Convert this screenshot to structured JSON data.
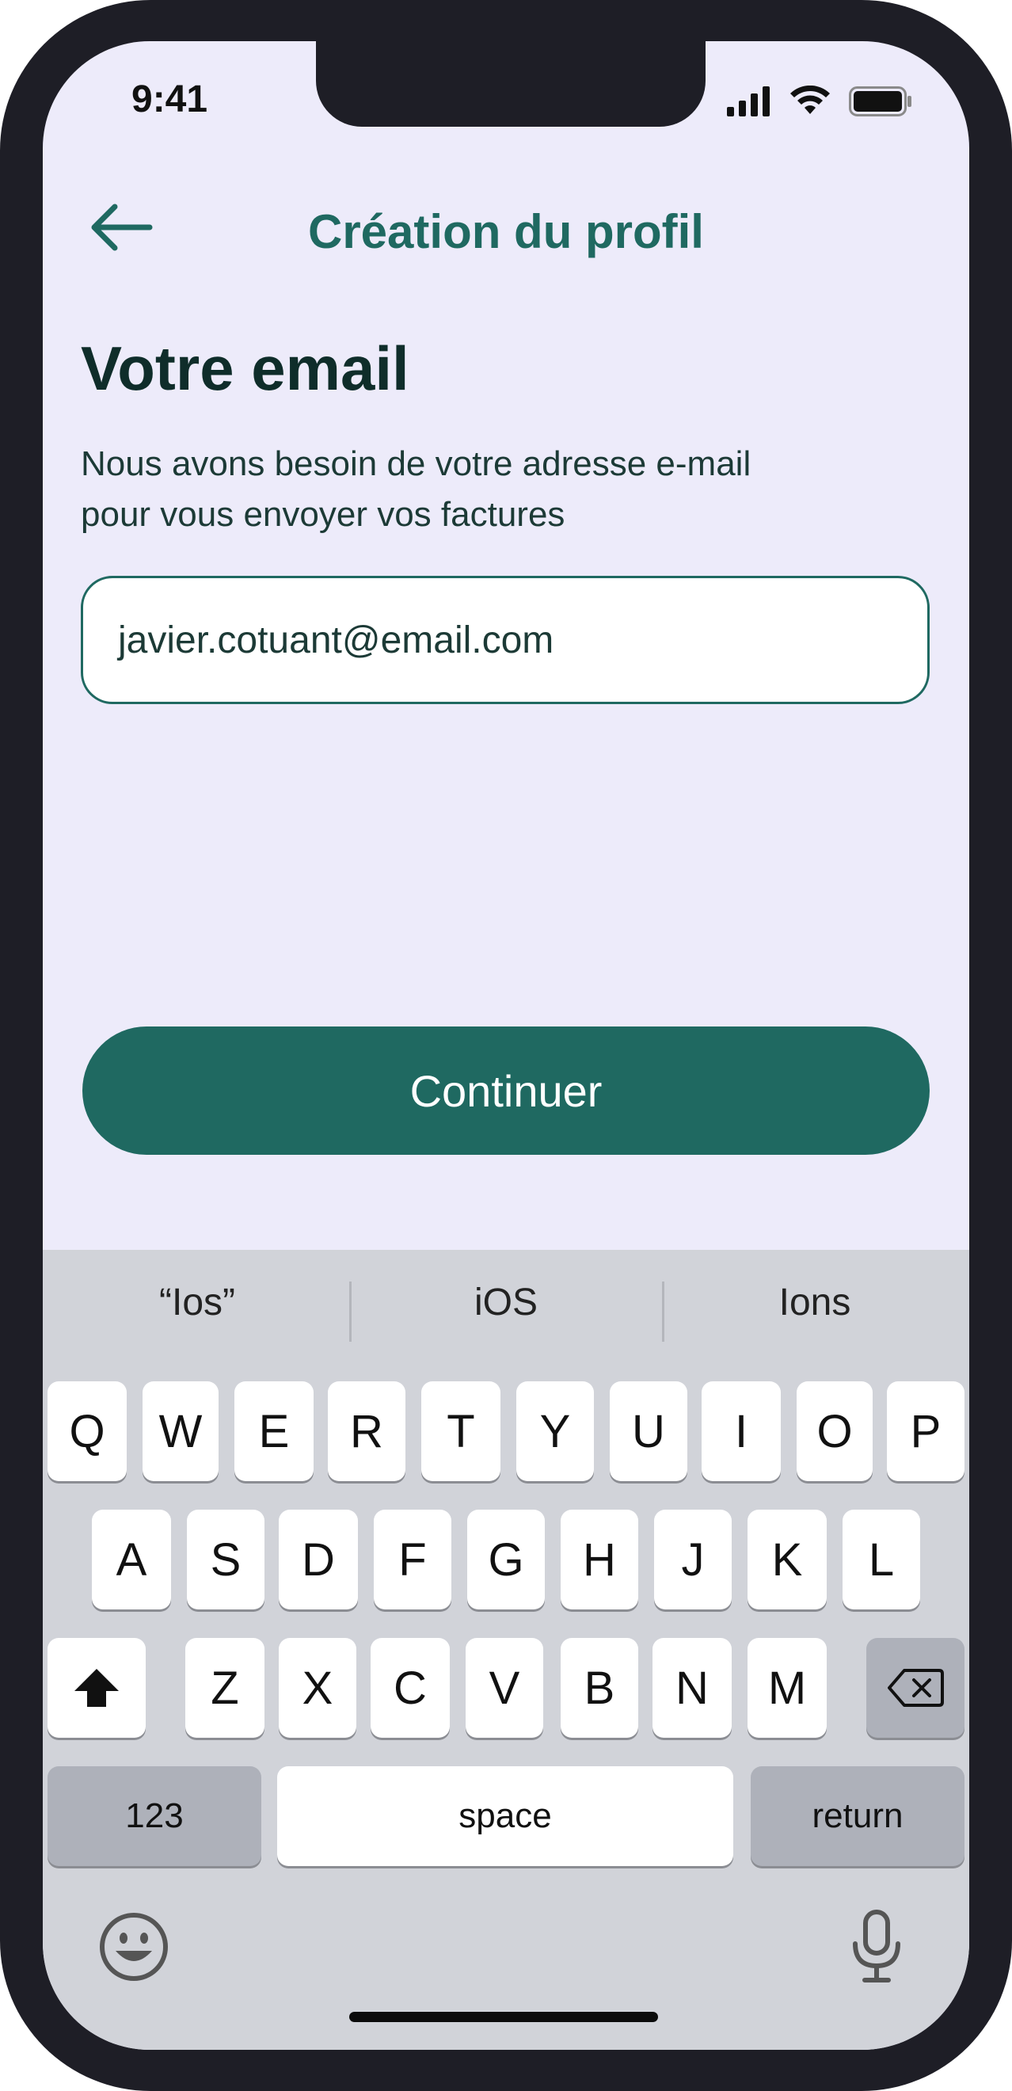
{
  "status_bar": {
    "time": "9:41"
  },
  "header": {
    "title": "Création du profil"
  },
  "main": {
    "heading": "Votre email",
    "subtitle_line1": "Nous avons besoin de votre adresse e-mail",
    "subtitle_line2": "pour vous envoyer vos factures",
    "email_value": "javier.cotuant@email.com",
    "continue_label": "Continuer"
  },
  "keyboard": {
    "suggestions": [
      "“Ios”",
      "iOS",
      "Ions"
    ],
    "row1": [
      "Q",
      "W",
      "E",
      "R",
      "T",
      "Y",
      "U",
      "I",
      "O",
      "P"
    ],
    "row2": [
      "A",
      "S",
      "D",
      "F",
      "G",
      "H",
      "J",
      "K",
      "L"
    ],
    "row3": [
      "Z",
      "X",
      "C",
      "V",
      "B",
      "N",
      "M"
    ],
    "numbers_label": "123",
    "space_label": "space",
    "return_label": "return"
  },
  "colors": {
    "brand": "#1f6961",
    "background": "#edebfa",
    "keyboard": "#d1d3d9"
  }
}
